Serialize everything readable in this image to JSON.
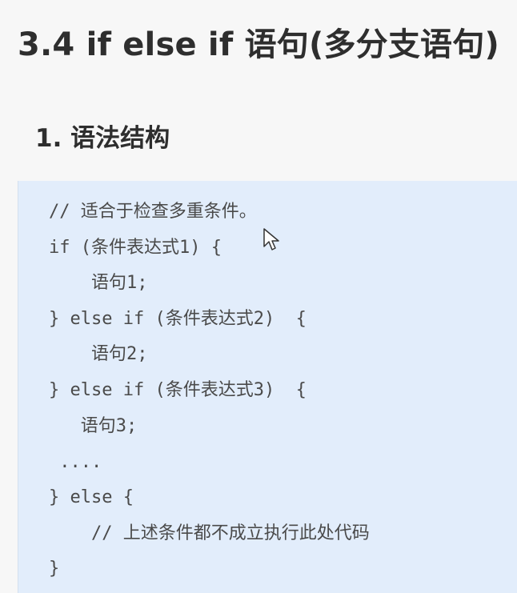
{
  "header": {
    "title": "3.4 if else if 语句(多分支语句)",
    "subtitle": "1. 语法结构"
  },
  "code": {
    "lines": [
      "// 适合于检查多重条件。",
      "if (条件表达式1) {",
      "    语句1;",
      "} else if (条件表达式2)  {",
      "    语句2;",
      "} else if (条件表达式3)  {",
      "   语句3;",
      " ....",
      "} else {",
      "    // 上述条件都不成立执行此处代码",
      "}"
    ]
  }
}
